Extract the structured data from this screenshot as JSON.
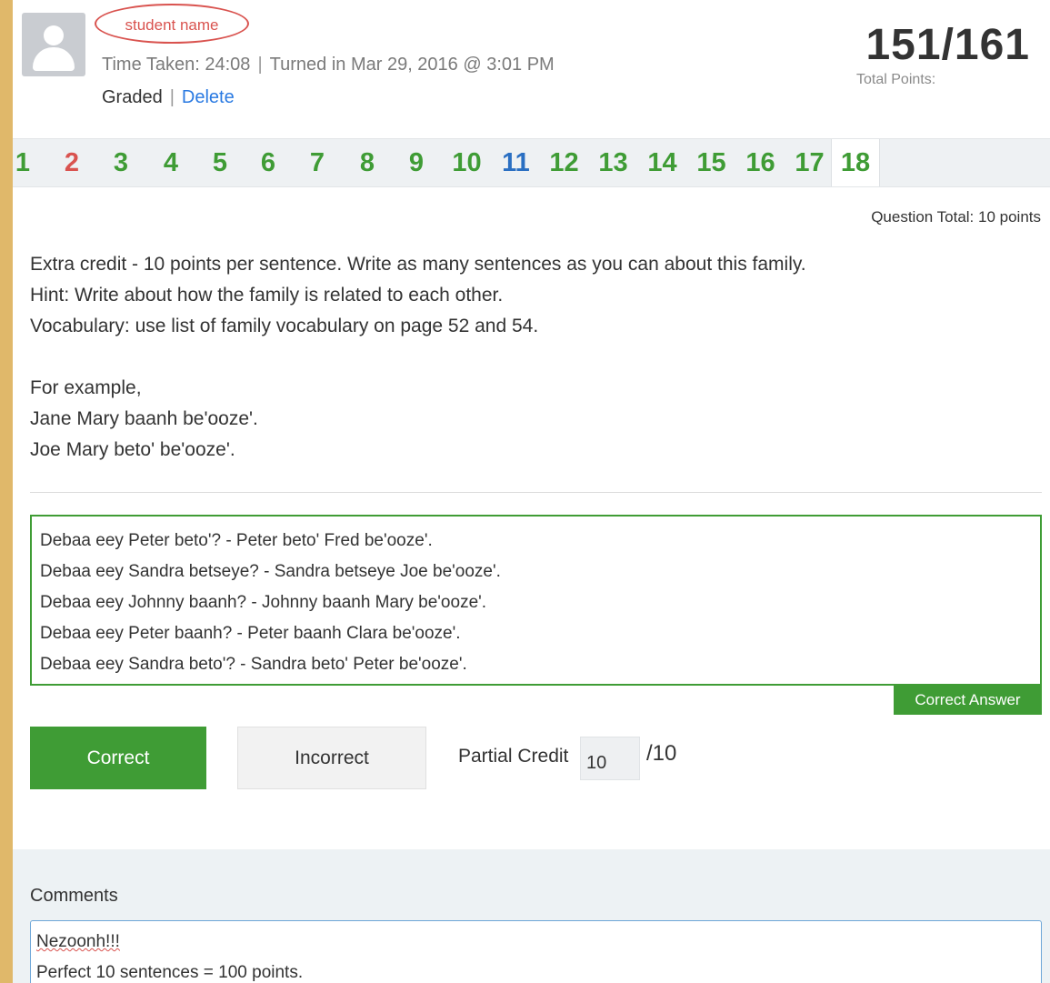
{
  "header": {
    "student_name": "student name",
    "time_taken": "Time Taken: 24:08",
    "turned_in": "Turned in Mar 29, 2016 @ 3:01 PM",
    "status": "Graded",
    "delete_label": "Delete",
    "score": "151/161",
    "score_label": "Total Points:"
  },
  "question_nav": {
    "items": [
      {
        "label": "1",
        "color": "#3f9c35"
      },
      {
        "label": "2",
        "color": "#d9534f"
      },
      {
        "label": "3",
        "color": "#3f9c35"
      },
      {
        "label": "4",
        "color": "#3f9c35"
      },
      {
        "label": "5",
        "color": "#3f9c35"
      },
      {
        "label": "6",
        "color": "#3f9c35"
      },
      {
        "label": "7",
        "color": "#3f9c35"
      },
      {
        "label": "8",
        "color": "#3f9c35"
      },
      {
        "label": "9",
        "color": "#3f9c35"
      },
      {
        "label": "10",
        "color": "#3f9c35"
      },
      {
        "label": "11",
        "color": "#2a6fc2"
      },
      {
        "label": "12",
        "color": "#3f9c35"
      },
      {
        "label": "13",
        "color": "#3f9c35"
      },
      {
        "label": "14",
        "color": "#3f9c35"
      },
      {
        "label": "15",
        "color": "#3f9c35"
      },
      {
        "label": "16",
        "color": "#3f9c35"
      },
      {
        "label": "17",
        "color": "#3f9c35"
      },
      {
        "label": "18",
        "color": "#3f9c35"
      }
    ],
    "active": "18"
  },
  "question": {
    "total": "Question Total: 10 points",
    "prompt_lines": [
      "Extra credit - 10 points per sentence. Write as many sentences as you can about this family.",
      "Hint: Write about how the family is related to each other.",
      "Vocabulary: use list of family vocabulary on page 52 and 54."
    ],
    "example_lines": [
      "For example,",
      "Jane Mary baanh be'ooze'.",
      "Joe Mary beto' be'ooze'."
    ]
  },
  "answer": {
    "lines": [
      "Debaa eey Peter beto'? - Peter beto' Fred be'ooze'.",
      "Debaa eey Sandra betseye? - Sandra betseye Joe be'ooze'.",
      "Debaa eey Johnny baanh? - Johnny baanh Mary be'ooze'.",
      "Debaa eey Peter baanh? - Peter baanh Clara be'ooze'.",
      "Debaa eey Sandra beto'? - Sandra beto' Peter be'ooze'."
    ],
    "tag": "Correct Answer"
  },
  "grading": {
    "correct_label": "Correct",
    "incorrect_label": "Incorrect",
    "partial_label": "Partial Credit",
    "partial_value": "10",
    "partial_max": "/10"
  },
  "comments": {
    "label": "Comments",
    "line1": "Nezoonh!!!",
    "line2": "Perfect 10 sentences = 100 points."
  },
  "colors": {
    "accent_green": "#3f9c35",
    "incorrect_red": "#d9534f",
    "link_blue": "#2a7ae2",
    "page_background": "#e0b86a"
  }
}
